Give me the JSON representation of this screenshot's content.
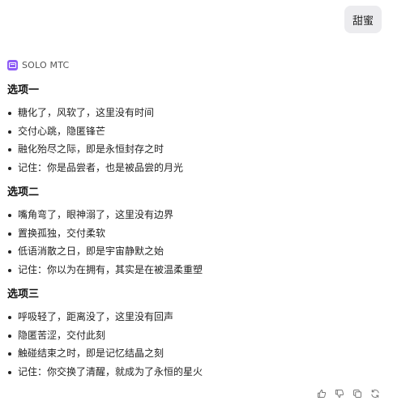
{
  "user_message": {
    "text": "甜蜜"
  },
  "bot": {
    "name": "SOLO MTC",
    "avatar_color": "#8e5cf6"
  },
  "response": {
    "sections": [
      {
        "title": "选项一",
        "items": [
          "糖化了，风软了，这里没有时间",
          "交付心跳，隐匿锋芒",
          "融化殆尽之际，即是永恒封存之时",
          "记住：你是品尝者，也是被品尝的月光"
        ]
      },
      {
        "title": "选项二",
        "items": [
          "嘴角弯了，眼神溺了，这里没有边界",
          "置换孤独，交付柔软",
          "低语消散之日，即是宇宙静默之始",
          "记住：你以为在拥有，其实是在被温柔重塑"
        ]
      },
      {
        "title": "选项三",
        "items": [
          "呼吸轻了，距离没了，这里没有回声",
          "隐匿苦涩，交付此刻",
          "触碰结束之时，即是记忆结晶之刻",
          "记住：你交换了清醒，就成为了永恒的星火"
        ]
      }
    ]
  },
  "actions": [
    {
      "icon": "thumbs-up-icon"
    },
    {
      "icon": "thumbs-down-icon"
    },
    {
      "icon": "copy-icon"
    },
    {
      "icon": "regenerate-icon"
    }
  ]
}
